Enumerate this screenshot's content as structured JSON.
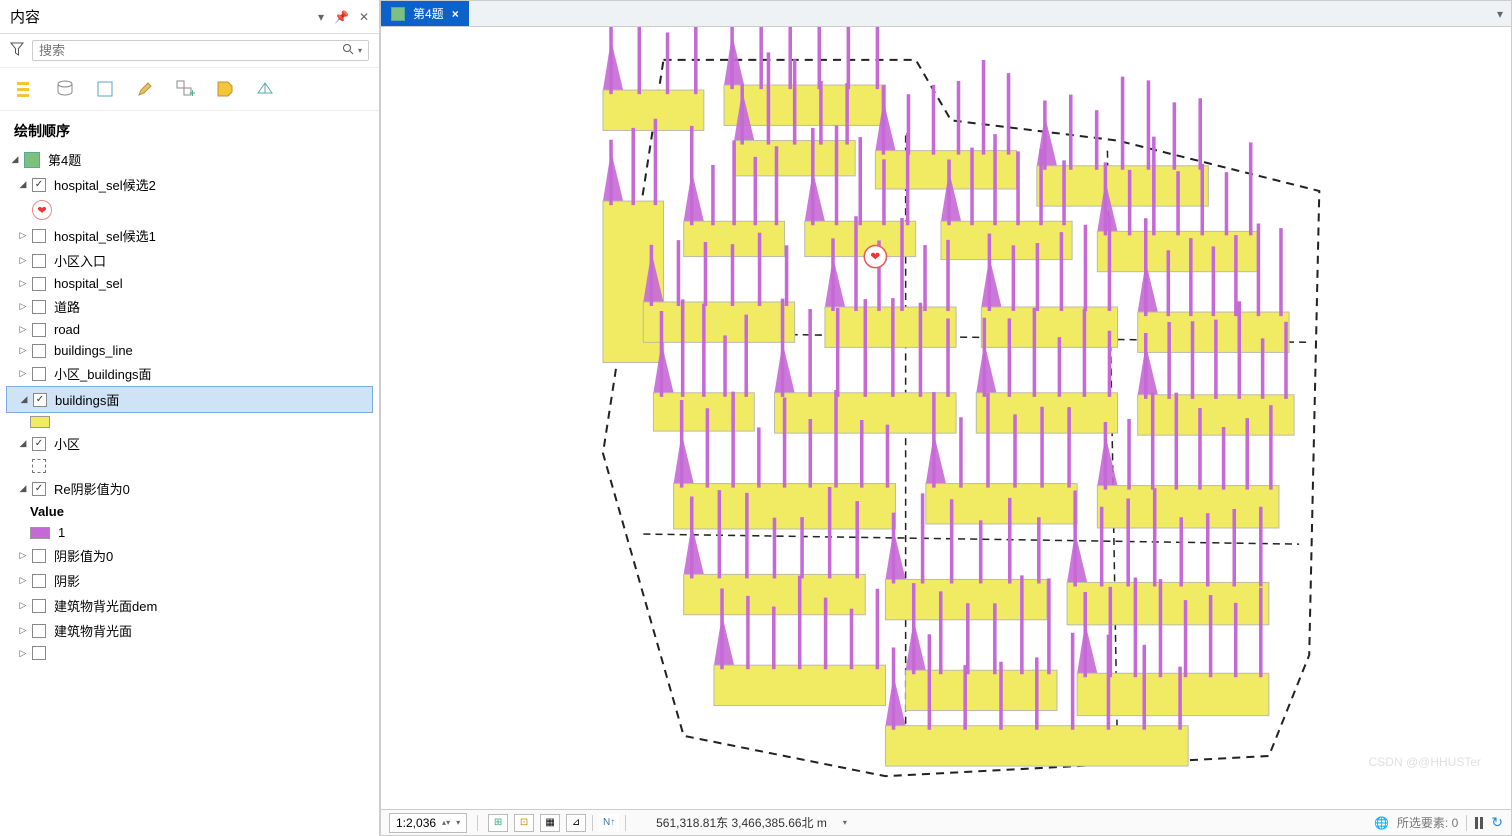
{
  "sidebar": {
    "title": "内容",
    "search_placeholder": "搜索",
    "section_title": "绘制顺序",
    "mapframe": "第4题",
    "heart_symbol": "❤",
    "value_heading": "Value",
    "value_1": "1",
    "layers": [
      {
        "label": "hospital_sel候选2",
        "checked": true,
        "expanded": true
      },
      {
        "label": "hospital_sel候选1",
        "checked": false
      },
      {
        "label": "小区入口",
        "checked": false
      },
      {
        "label": "hospital_sel",
        "checked": false
      },
      {
        "label": "道路",
        "checked": false
      },
      {
        "label": "road",
        "checked": false
      },
      {
        "label": "buildings_line",
        "checked": false
      },
      {
        "label": "小区_buildings面",
        "checked": false
      },
      {
        "label": "buildings面",
        "checked": true,
        "expanded": true,
        "selected": true
      },
      {
        "label": "小区",
        "checked": true,
        "expanded": true
      },
      {
        "label": "Re阴影值为0",
        "checked": true,
        "expanded": true
      },
      {
        "label": "阴影值为0",
        "checked": false
      },
      {
        "label": "阴影",
        "checked": false
      },
      {
        "label": "建筑物背光面dem",
        "checked": false
      },
      {
        "label": "建筑物背光面",
        "checked": false
      }
    ]
  },
  "tab": {
    "title": "第4题"
  },
  "status": {
    "scale": "1:2,036",
    "coords": "561,318.81东 3,466,385.66北 m",
    "selection_label": "所选要素: 0"
  },
  "colors": {
    "building_fill": "#f0eb63",
    "shadow_fill": "#c569d6",
    "accent": "#0d62c9"
  },
  "watermark": "CSDN @@HHUSTer"
}
